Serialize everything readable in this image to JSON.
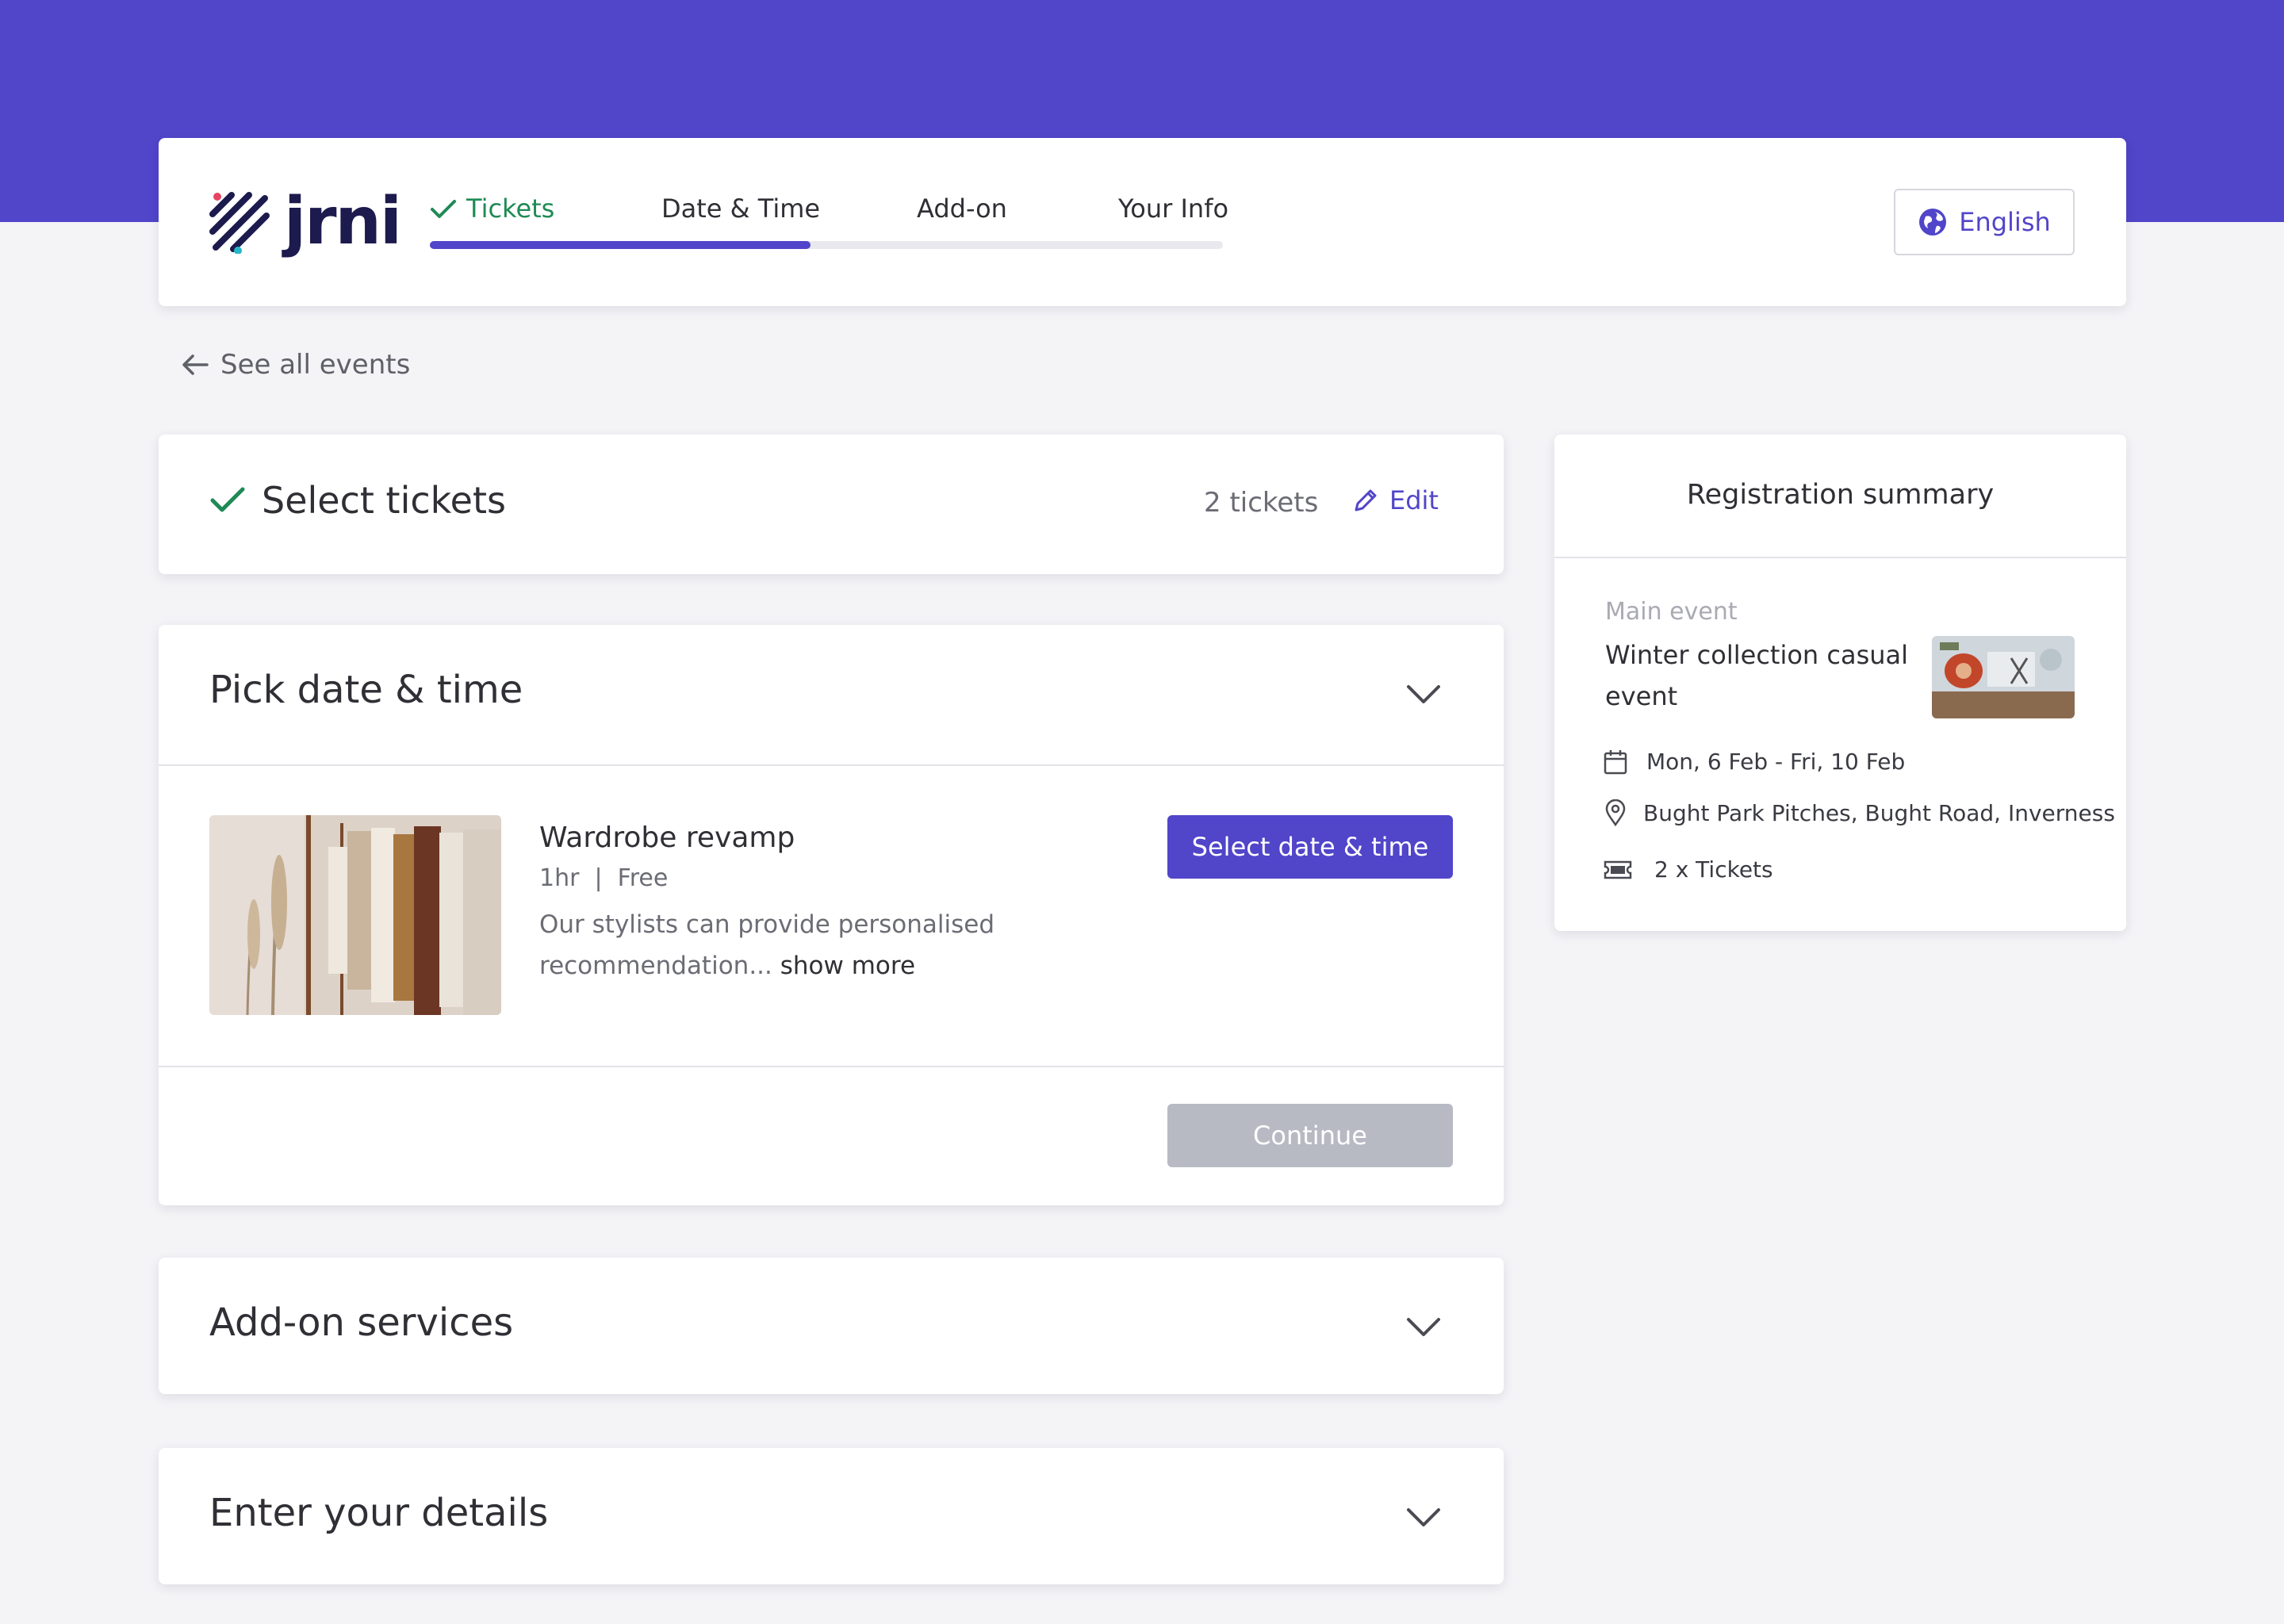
{
  "brand": {
    "name": "jrni",
    "accent": "#5145c9",
    "success": "#1f8a55"
  },
  "steps": {
    "items": [
      {
        "label": "Tickets",
        "state": "complete"
      },
      {
        "label": "Date & Time",
        "state": "current"
      },
      {
        "label": "Add-on",
        "state": "upcoming"
      },
      {
        "label": "Your Info",
        "state": "upcoming"
      }
    ],
    "progress": 0.48
  },
  "language": {
    "label": "English",
    "icon": "globe-icon"
  },
  "back_link": {
    "label": "See all events",
    "icon": "arrow-left-icon"
  },
  "select_tickets": {
    "title": "Select tickets",
    "count": "2 tickets",
    "edit_label": "Edit"
  },
  "pick_date": {
    "title": "Pick date & time",
    "service": {
      "name": "Wardrobe revamp",
      "meta": "1hr  |  Free",
      "description": "Our stylists can provide personalised recommendation...",
      "show_more": "show more",
      "button": "Select date & time"
    },
    "continue_label": "Continue"
  },
  "addon": {
    "title": "Add-on services"
  },
  "details": {
    "title": "Enter your details"
  },
  "summary": {
    "title": "Registration summary",
    "label": "Main event",
    "event_name": "Winter collection casual event",
    "date": "Mon, 6 Feb - Fri, 10 Feb",
    "location": "Bught Park Pitches, Bught Road, Inverness",
    "tickets": "2 x Tickets"
  }
}
